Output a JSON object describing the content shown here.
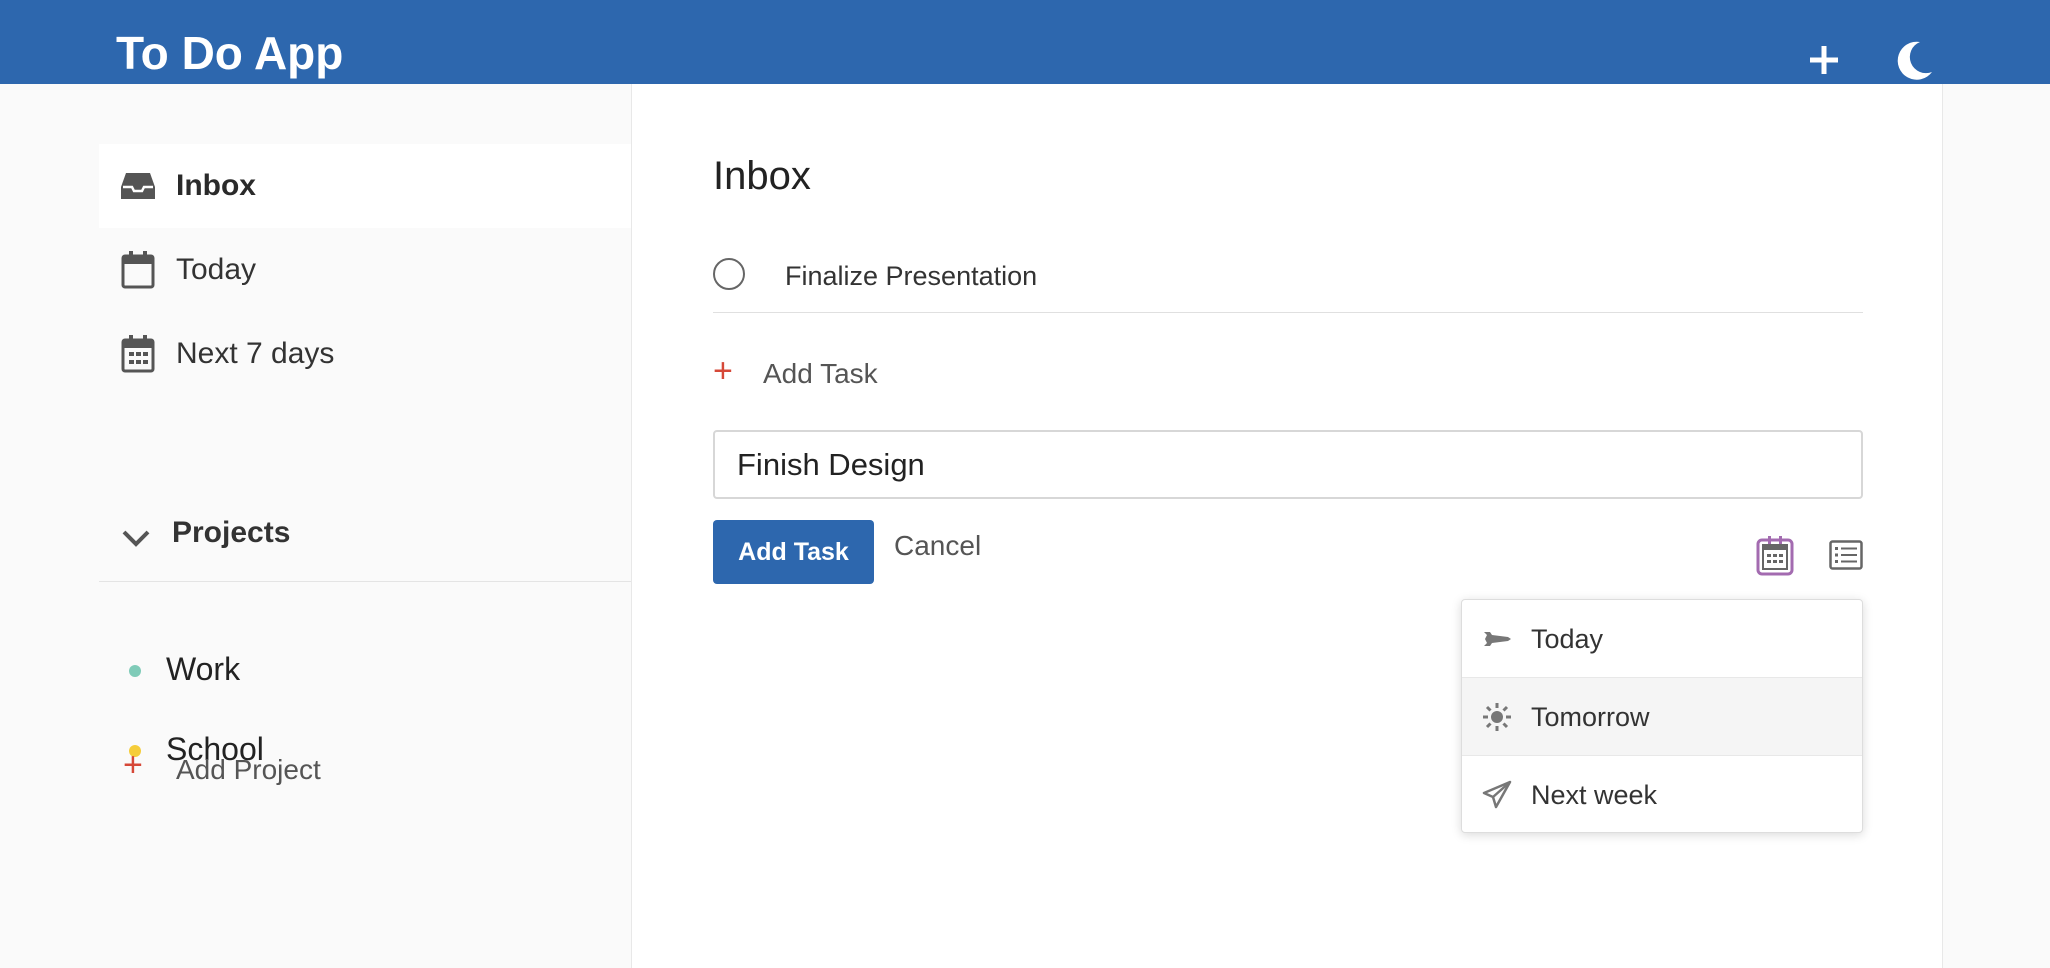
{
  "header": {
    "title": "To Do App",
    "add_icon": "plus-icon",
    "theme_icon": "moon-icon"
  },
  "sidebar": {
    "items": [
      {
        "label": "Inbox",
        "icon": "inbox-icon",
        "active": true
      },
      {
        "label": "Today",
        "icon": "calendar-icon"
      },
      {
        "label": "Next 7 days",
        "icon": "calendar-grid-icon"
      }
    ],
    "projects_label": "Projects",
    "projects": [
      {
        "label": "Work",
        "color": "#7fcbb8"
      },
      {
        "label": "School",
        "color": "#f5cd3a"
      }
    ],
    "add_project_label": "Add Project"
  },
  "main": {
    "title": "Inbox",
    "tasks": [
      {
        "text": "Finalize Presentation"
      }
    ],
    "add_task_link": "Add Task",
    "task_input_value": "Finish Design",
    "add_task_button": "Add Task",
    "cancel_label": "Cancel",
    "date_menu": [
      {
        "label": "Today",
        "icon": "spaceship-icon"
      },
      {
        "label": "Tomorrow",
        "icon": "sun-icon"
      },
      {
        "label": "Next week",
        "icon": "paper-plane-icon"
      }
    ]
  },
  "colors": {
    "brand": "#2d67ae",
    "accent_red": "#d64838",
    "calendar_highlight": "#a36bb0"
  }
}
